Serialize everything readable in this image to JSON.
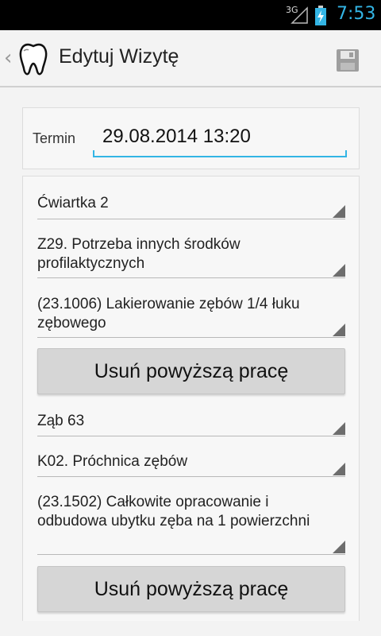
{
  "status_bar": {
    "network": "3G",
    "time": "7:53"
  },
  "action_bar": {
    "title": "Edytuj Wizytę",
    "save_icon": "save-icon",
    "app_icon": "tooth-icon"
  },
  "termin": {
    "label": "Termin",
    "value": "29.08.2014 13:20"
  },
  "procedures": [
    {
      "quarter": "Ćwiartka 2",
      "diagnosis": "Z29. Potrzeba innych środków profilaktycznych",
      "treatment": "(23.1006) Lakierowanie zębów 1/4 łuku zębowego",
      "remove_label": "Usuń powyższą pracę"
    },
    {
      "quarter": "Ząb 63",
      "diagnosis": "K02. Próchnica zębów",
      "treatment": "(23.1502) Całkowite opracowanie i odbudowa ubytku zęba na 1 powierzchni",
      "remove_label": "Usuń powyższą pracę"
    }
  ],
  "colors": {
    "accent": "#33b5e5",
    "background": "#f3f3f3"
  }
}
